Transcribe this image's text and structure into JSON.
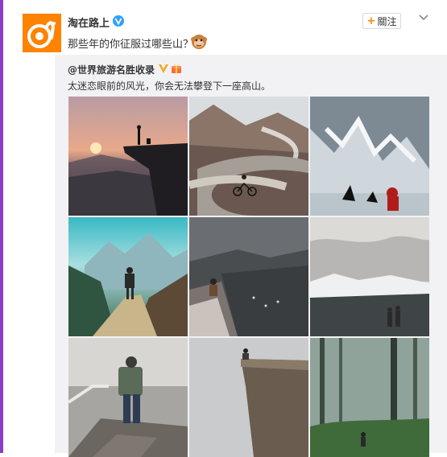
{
  "post": {
    "author": "淘在路上",
    "text": "那些年的你征服过哪些山？",
    "follow_label": "關注",
    "follow_icon": "+",
    "avatar_icon": "snail-logo-icon",
    "emoji_icon": "monkey-face-emoji-icon",
    "verified_icon": "verified-v-badge-icon"
  },
  "repost": {
    "author": "@世界旅游名胜收录",
    "text": "太迷恋眼前的风光，你会无法攀登下一座高山。",
    "badges": [
      "gold-v-badge-icon",
      "gift-badge-icon"
    ]
  },
  "photos": [
    {
      "subject": "sunset-cliff-hikers-photo"
    },
    {
      "subject": "mountain-road-cyclist-photo"
    },
    {
      "subject": "snow-lake-orcas-photo"
    },
    {
      "subject": "mountain-trail-hiker-photo"
    },
    {
      "subject": "cliff-edge-valley-photo"
    },
    {
      "subject": "snowy-plateau-couple-photo"
    },
    {
      "subject": "stone-stairs-hiker-photo"
    },
    {
      "subject": "misty-cliff-sitter-photo"
    },
    {
      "subject": "foggy-forest-walker-photo"
    }
  ],
  "colors": {
    "accent": "#ff8200",
    "sidebar": "#8a3ec8",
    "repost_bg": "#f2f2f5",
    "verified": "#2da1ff"
  }
}
